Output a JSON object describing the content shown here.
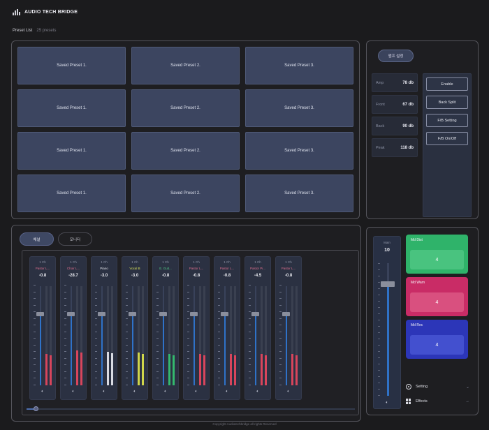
{
  "app": {
    "title": "AUDIO TECH BRIDGE",
    "icon": "audio-bars-icon"
  },
  "preset_list": {
    "label": "Preset List",
    "count_text": "25 presets"
  },
  "presets": [
    "Saved Preset 1.",
    "Saved Preset 2.",
    "Saved Preset 3.",
    "Saved Preset 1.",
    "Saved Preset 2.",
    "Saved Preset 3.",
    "Saved Preset 1.",
    "Saved Preset 2.",
    "Saved Preset 3.",
    "Saved Preset 1.",
    "Saved Preset 2.",
    "Saved Preset 3."
  ],
  "amp_panel": {
    "pill_label": "앰프 설정",
    "meters": [
      {
        "key": "Amp",
        "value": "78 db"
      },
      {
        "key": "Front",
        "value": "67 db"
      },
      {
        "key": "Back",
        "value": "90 db"
      },
      {
        "key": "Peak",
        "value": "118 db"
      }
    ],
    "buttons": [
      "Enable",
      "Back Split",
      "F/B Setting",
      "F/B On/Off"
    ]
  },
  "mixer": {
    "tabs": [
      {
        "label": "채널",
        "active": true
      },
      {
        "label": "모니터",
        "active": false
      }
    ],
    "channels": [
      {
        "ch": "1 Ch",
        "name": "Pastor L...",
        "name_color": "#e0708f",
        "db": "-0.8",
        "fader_level": 0.72,
        "meter_color": "#d8455c",
        "meter_level": 0.32
      },
      {
        "ch": "1 Ch",
        "name": "Choir L...",
        "name_color": "#e0708f",
        "db": "-28.7",
        "fader_level": 0.72,
        "meter_color": "#d8455c",
        "meter_level": 0.35
      },
      {
        "ch": "1 Ch",
        "name": "Piano",
        "name_color": "#e9eaf0",
        "db": "-3.0",
        "fader_level": 0.72,
        "meter_color": "#d9dbe3",
        "meter_level": 0.34
      },
      {
        "ch": "1 Ch",
        "name": "Vocal B",
        "name_color": "#d9e25a",
        "db": "-3.0",
        "fader_level": 0.72,
        "meter_color": "#cfd64a",
        "meter_level": 0.33
      },
      {
        "ch": "1 Ch",
        "name": "E. Guit...",
        "name_color": "#52d089",
        "db": "-0.8",
        "fader_level": 0.72,
        "meter_color": "#34b96e",
        "meter_level": 0.32
      },
      {
        "ch": "1 Ch",
        "name": "Pastor L...",
        "name_color": "#e0708f",
        "db": "-0.8",
        "fader_level": 0.72,
        "meter_color": "#d8455c",
        "meter_level": 0.32
      },
      {
        "ch": "1 Ch",
        "name": "Pastor L...",
        "name_color": "#e0708f",
        "db": "-0.8",
        "fader_level": 0.72,
        "meter_color": "#d8455c",
        "meter_level": 0.32
      },
      {
        "ch": "1 Ch",
        "name": "Pastor Pi...",
        "name_color": "#e0708f",
        "db": "-4.5",
        "fader_level": 0.72,
        "meter_color": "#d8455c",
        "meter_level": 0.32
      },
      {
        "ch": "1 Ch",
        "name": "Pastor L...",
        "name_color": "#e0708f",
        "db": "-0.8",
        "fader_level": 0.72,
        "meter_color": "#d8455c",
        "meter_level": 0.32
      }
    ],
    "speaker_icon": "speaker-icon"
  },
  "master": {
    "label": "Main",
    "value": "10",
    "fader_level": 0.84
  },
  "effects": [
    {
      "label": "Md Dist",
      "value": "4",
      "color": "#2fb36a",
      "inner": "#49c37f"
    },
    {
      "label": "Md Warn",
      "value": "4",
      "color": "#c92c66",
      "inner": "#d9507f"
    },
    {
      "label": "Md Rec",
      "value": "4",
      "color": "#2c36b8",
      "inner": "#4350cf"
    }
  ],
  "side_menu": [
    {
      "label": "Setting",
      "icon": "gear-icon",
      "arrow": "⌄"
    },
    {
      "label": "Effects",
      "icon": "grid-icon",
      "arrow": "→"
    }
  ],
  "footer": "Copyright Audiotechbridge all rights Reserved"
}
